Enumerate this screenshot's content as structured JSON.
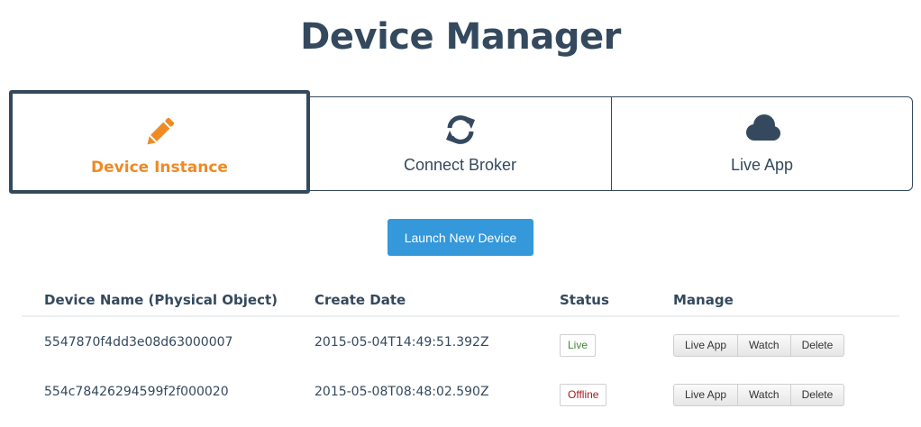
{
  "page": {
    "title": "Device Manager"
  },
  "tabs": [
    {
      "label": "Device Instance",
      "icon": "pencil-icon",
      "active": true
    },
    {
      "label": "Connect Broker",
      "icon": "refresh-icon",
      "active": false
    },
    {
      "label": "Live App",
      "icon": "cloud-icon",
      "active": false
    }
  ],
  "actions": {
    "launch_label": "Launch New Device"
  },
  "table": {
    "headers": [
      "Device Name (Physical Object)",
      "Create Date",
      "Status",
      "Manage"
    ],
    "rows": [
      {
        "name": "5547870f4dd3e08d63000007",
        "date": "2015-05-04T14:49:51.392Z",
        "status": "Live",
        "manage": [
          "Live App",
          "Watch",
          "Delete"
        ]
      },
      {
        "name": "554c78426294599f2f000020",
        "date": "2015-05-08T08:48:02.590Z",
        "status": "Offline",
        "manage": [
          "Live App",
          "Watch",
          "Delete"
        ]
      }
    ]
  },
  "colors": {
    "accent": "#f08a24",
    "primary": "#34495e",
    "button": "#3498db"
  }
}
